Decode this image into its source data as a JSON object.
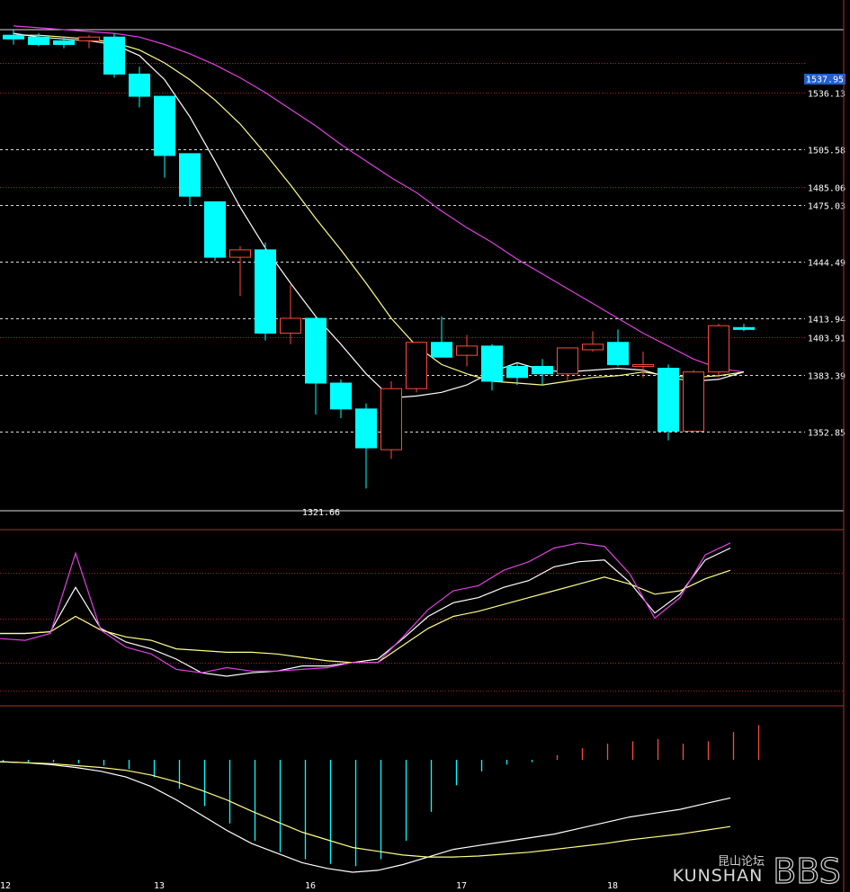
{
  "colors": {
    "background": "#000000",
    "up": "#ff4a3d",
    "down": "#00ffff",
    "ma_short": "#ffffff",
    "ma_mid": "#ffff88",
    "ma_long": "#e040e0",
    "panel_border": "#b03030",
    "dotted_red": "#b02020",
    "dotted_white": "#dddddd",
    "price_tag_bg": "#1f5fd0"
  },
  "chart_data": [
    {
      "type": "candlestick",
      "price_labels": [
        "1536.13",
        "1505.58",
        "1485.06",
        "1475.03",
        "1444.49",
        "1413.94",
        "1403.91",
        "1383.39",
        "1352.85"
      ],
      "current_price": "1537.95",
      "min_label": "1321.66",
      "ylim": [
        1310,
        1570
      ],
      "x_labels": [
        {
          "text": "12",
          "index": 0
        },
        {
          "text": "13",
          "index": 6
        },
        {
          "text": "16",
          "index": 12
        },
        {
          "text": "17",
          "index": 18
        },
        {
          "text": "18",
          "index": 24
        }
      ],
      "candles": [
        {
          "o": 1567,
          "h": 1570,
          "l": 1562,
          "c": 1565
        },
        {
          "o": 1566,
          "h": 1568,
          "l": 1561,
          "c": 1562
        },
        {
          "o": 1564,
          "h": 1566,
          "l": 1560,
          "c": 1562
        },
        {
          "o": 1564,
          "h": 1567,
          "l": 1560,
          "c": 1566
        },
        {
          "o": 1566,
          "h": 1568,
          "l": 1544,
          "c": 1546
        },
        {
          "o": 1546,
          "h": 1550,
          "l": 1528,
          "c": 1534
        },
        {
          "o": 1534,
          "h": 1534,
          "l": 1490,
          "c": 1502
        },
        {
          "o": 1503,
          "h": 1503,
          "l": 1475,
          "c": 1480
        },
        {
          "o": 1477,
          "h": 1477,
          "l": 1445,
          "c": 1447
        },
        {
          "o": 1447,
          "h": 1453,
          "l": 1426,
          "c": 1451
        },
        {
          "o": 1451,
          "h": 1455,
          "l": 1402,
          "c": 1406
        },
        {
          "o": 1406,
          "h": 1432,
          "l": 1400,
          "c": 1414
        },
        {
          "o": 1414,
          "h": 1415,
          "l": 1362,
          "c": 1379
        },
        {
          "o": 1379,
          "h": 1381,
          "l": 1360,
          "c": 1365
        },
        {
          "o": 1365,
          "h": 1368,
          "l": 1322,
          "c": 1344
        },
        {
          "o": 1343,
          "h": 1380,
          "l": 1338,
          "c": 1376
        },
        {
          "o": 1376,
          "h": 1400,
          "l": 1374,
          "c": 1401
        },
        {
          "o": 1401,
          "h": 1415,
          "l": 1393,
          "c": 1393
        },
        {
          "o": 1394,
          "h": 1405,
          "l": 1388,
          "c": 1399
        },
        {
          "o": 1399,
          "h": 1400,
          "l": 1375,
          "c": 1380
        },
        {
          "o": 1388,
          "h": 1390,
          "l": 1378,
          "c": 1382
        },
        {
          "o": 1388,
          "h": 1392,
          "l": 1378,
          "c": 1384
        },
        {
          "o": 1384,
          "h": 1398,
          "l": 1380,
          "c": 1398
        },
        {
          "o": 1397,
          "h": 1407,
          "l": 1396,
          "c": 1400
        },
        {
          "o": 1401,
          "h": 1408,
          "l": 1388,
          "c": 1389
        },
        {
          "o": 1389,
          "h": 1396,
          "l": 1382,
          "c": 1389
        },
        {
          "o": 1387,
          "h": 1389,
          "l": 1348,
          "c": 1353
        },
        {
          "o": 1353,
          "h": 1386,
          "l": 1352,
          "c": 1385
        },
        {
          "o": 1385,
          "h": 1411,
          "l": 1382,
          "c": 1410
        },
        {
          "o": 1409,
          "h": 1411,
          "l": 1407,
          "c": 1408
        }
      ],
      "ma_short": [
        1568,
        1566,
        1565,
        1564,
        1562,
        1556,
        1543,
        1523,
        1499,
        1474,
        1452,
        1433,
        1415,
        1400,
        1384,
        1371,
        1372,
        1374,
        1378,
        1385,
        1390,
        1386,
        1385,
        1386,
        1387,
        1386,
        1382,
        1380,
        1381,
        1385
      ],
      "ma_mid": [
        1567,
        1567,
        1566,
        1565,
        1563,
        1559,
        1552,
        1543,
        1532,
        1519,
        1503,
        1486,
        1468,
        1451,
        1433,
        1414,
        1399,
        1389,
        1384,
        1380,
        1379,
        1378,
        1380,
        1382,
        1383,
        1385,
        1383,
        1382,
        1383,
        1385
      ],
      "ma_long": [
        1572,
        1571,
        1570,
        1569,
        1568,
        1566,
        1562,
        1557,
        1551,
        1544,
        1536,
        1527,
        1518,
        1508,
        1499,
        1490,
        1482,
        1472,
        1463,
        1455,
        1446,
        1438,
        1430,
        1422,
        1414,
        1406,
        1399,
        1392,
        1387,
        1385
      ]
    },
    {
      "type": "line",
      "name": "oscillator",
      "ylim": [
        0,
        100
      ],
      "lines": [
        {
          "key": "k",
          "values": [
            45,
            45,
            46,
            72,
            48,
            40,
            36,
            30,
            22,
            20,
            22,
            23,
            26,
            26,
            28,
            30,
            42,
            55,
            63,
            66,
            72,
            76,
            84,
            87,
            88,
            75,
            57,
            68,
            88,
            95
          ]
        },
        {
          "key": "d",
          "values": [
            45,
            45,
            46,
            55,
            47,
            43,
            41,
            36,
            35,
            34,
            34,
            33,
            31,
            29,
            28,
            28,
            38,
            48,
            55,
            58,
            62,
            66,
            70,
            74,
            78,
            74,
            68,
            70,
            77,
            82
          ]
        },
        {
          "key": "j",
          "values": [
            42,
            41,
            45,
            92,
            47,
            37,
            33,
            24,
            22,
            25,
            23,
            23,
            24,
            25,
            28,
            28,
            43,
            59,
            70,
            73,
            82,
            87,
            95,
            98,
            96,
            80,
            54,
            66,
            91,
            98
          ]
        }
      ]
    },
    {
      "type": "bar",
      "name": "histogram",
      "ylim": [
        -100,
        40
      ],
      "values": [
        -2,
        -2,
        -2,
        -3,
        -5,
        -8,
        -15,
        -25,
        -40,
        -55,
        -70,
        -80,
        -86,
        -90,
        -92,
        -86,
        -70,
        -45,
        -22,
        -10,
        -4,
        -2,
        4,
        10,
        14,
        16,
        18,
        14,
        16,
        24,
        30
      ],
      "dif": [
        -2,
        -3,
        -5,
        -8,
        -12,
        -18,
        -28,
        -42,
        -58,
        -74,
        -88,
        -98,
        -108,
        -114,
        -118,
        -116,
        -110,
        -102,
        -94,
        -90,
        -86,
        -82,
        -78,
        -72,
        -66,
        -60,
        -56,
        -52,
        -46,
        -40
      ],
      "dea": [
        -2,
        -3,
        -4,
        -6,
        -8,
        -11,
        -16,
        -23,
        -32,
        -42,
        -54,
        -65,
        -76,
        -84,
        -92,
        -96,
        -100,
        -102,
        -102,
        -101,
        -99,
        -97,
        -94,
        -91,
        -88,
        -84,
        -81,
        -78,
        -74,
        -70
      ]
    }
  ],
  "watermark": {
    "cn": "昆山论坛",
    "en": "KUNSHAN",
    "bbs": "BBS"
  }
}
